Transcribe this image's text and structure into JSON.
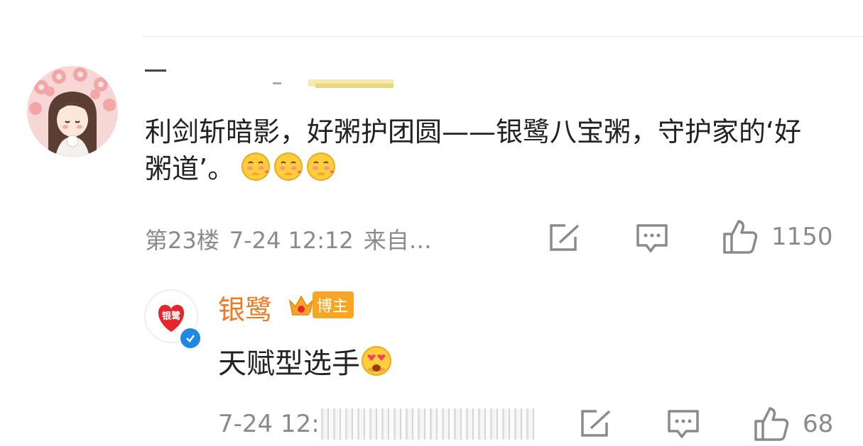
{
  "top_cut_text": "",
  "comment": {
    "author_masked": "",
    "text": "利剑斩暗影，好粥护团圆——银鹭八宝粥，守护家的‘好粥道’。",
    "emojis": [
      "blushing-face-emoji",
      "blushing-face-emoji",
      "blushing-face-emoji"
    ],
    "floor": "第23楼",
    "time": "7-24 12:12",
    "source": "来自…",
    "like_count": "1150"
  },
  "reply": {
    "author": "银鹭",
    "badge_label": "博主",
    "text": "天赋型选手",
    "emoji": "heart-eyes-emoji",
    "time": "7-24 12:",
    "like_count": "68"
  },
  "colors": {
    "author_orange": "#f07a22",
    "badge_gold": "#f6a623",
    "meta_gray": "#8a8a8a",
    "verified_blue": "#1e88e5"
  }
}
